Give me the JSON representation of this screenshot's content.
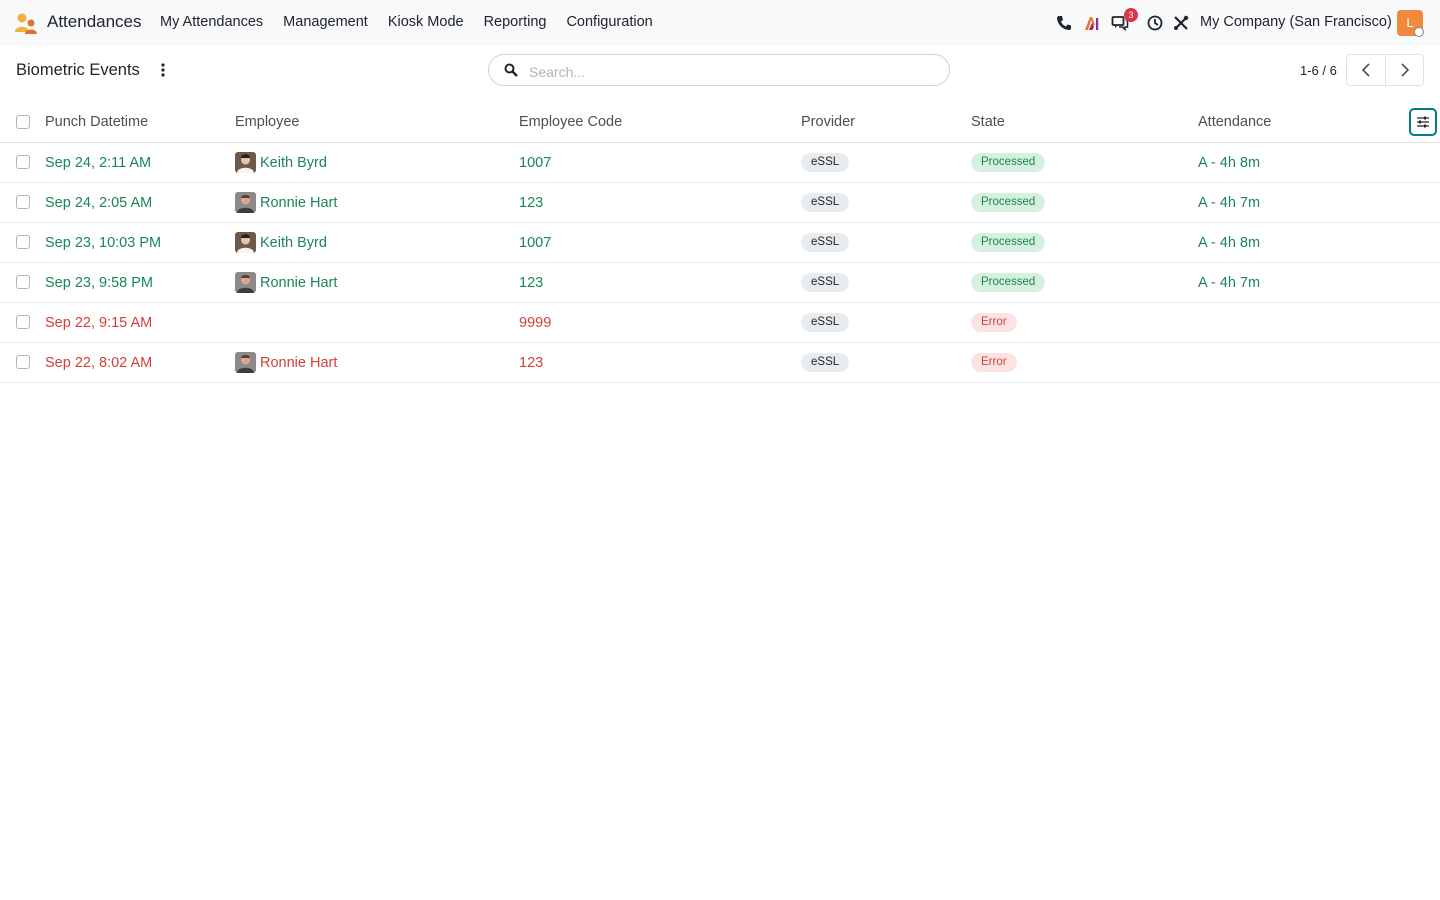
{
  "app": {
    "name": "Attendances"
  },
  "nav": {
    "items": [
      "My Attendances",
      "Management",
      "Kiosk Mode",
      "Reporting",
      "Configuration"
    ]
  },
  "systray": {
    "icons": [
      "phone-icon",
      "ai-icon",
      "messages-icon",
      "clock-icon",
      "tools-icon"
    ],
    "message_count": "3",
    "company": "My Company (San Francisco)",
    "user_initial": "L"
  },
  "control_panel": {
    "title": "Biometric Events",
    "search_placeholder": "Search...",
    "pager": "1-6 / 6"
  },
  "table": {
    "headers": {
      "punch_datetime": "Punch Datetime",
      "employee": "Employee",
      "employee_code": "Employee Code",
      "provider": "Provider",
      "state": "State",
      "attendance": "Attendance"
    },
    "rows": [
      {
        "datetime": "Sep 24, 2:11 AM",
        "employee": "Keith Byrd",
        "code": "1007",
        "provider": "eSSL",
        "state": "Processed",
        "attendance": "A - 4h 8m"
      },
      {
        "datetime": "Sep 24, 2:05 AM",
        "employee": "Ronnie Hart",
        "code": "123",
        "provider": "eSSL",
        "state": "Processed",
        "attendance": "A - 4h 7m"
      },
      {
        "datetime": "Sep 23, 10:03 PM",
        "employee": "Keith Byrd",
        "code": "1007",
        "provider": "eSSL",
        "state": "Processed",
        "attendance": "A - 4h 8m"
      },
      {
        "datetime": "Sep 23, 9:58 PM",
        "employee": "Ronnie Hart",
        "code": "123",
        "provider": "eSSL",
        "state": "Processed",
        "attendance": "A - 4h 7m"
      },
      {
        "datetime": "Sep 22, 9:15 AM",
        "employee": "",
        "code": "9999",
        "provider": "eSSL",
        "state": "Error",
        "attendance": ""
      },
      {
        "datetime": "Sep 22, 8:02 AM",
        "employee": "Ronnie Hart",
        "code": "123",
        "provider": "eSSL",
        "state": "Error",
        "attendance": ""
      }
    ]
  },
  "colors": {
    "processed": "#198754",
    "error": "#d23f3a",
    "accent": "#017e84",
    "badge": "#dc3545"
  }
}
